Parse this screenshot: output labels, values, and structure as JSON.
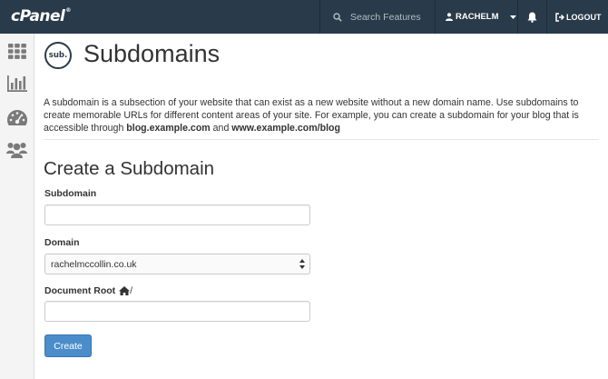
{
  "app": {
    "logo_text": "cPanel",
    "logo_mark": "®"
  },
  "header": {
    "search_placeholder": "Search Features",
    "username": "RACHELM",
    "logout_label": "LOGOUT",
    "icons": [
      "search-icon",
      "user-icon",
      "caret-down-icon",
      "bell-icon",
      "logout-icon"
    ]
  },
  "sidebar": {
    "items": [
      {
        "name": "home",
        "icon": "grid-icon"
      },
      {
        "name": "statistics",
        "icon": "bar-chart-icon"
      },
      {
        "name": "dashboard",
        "icon": "gauge-icon"
      },
      {
        "name": "users",
        "icon": "users-icon"
      }
    ]
  },
  "page": {
    "icon_text": "sub.",
    "title": "Subdomains",
    "intro_text": "A subdomain is a subsection of your website that can exist as a new website without a new domain name. Use subdomains to create memorable URLs for different content areas of your site. For example, you can create a subdomain for your blog that is accessible through ",
    "intro_example1": "blog.example.com",
    "intro_and": " and ",
    "intro_example2": "www.example.com/blog"
  },
  "form": {
    "section_title": "Create a Subdomain",
    "subdomain_label": "Subdomain",
    "subdomain_value": "",
    "domain_label": "Domain",
    "domain_selected": "rachelmccollin.co.uk",
    "docroot_label": "Document Root",
    "docroot_prefix": "/",
    "docroot_value": "",
    "submit_label": "Create"
  },
  "colors": {
    "topbar": "#293a4a",
    "sidebar_bg": "#f4f4f4",
    "primary_button": "#4b8dcb",
    "icon_gray": "#7a7a7a"
  }
}
